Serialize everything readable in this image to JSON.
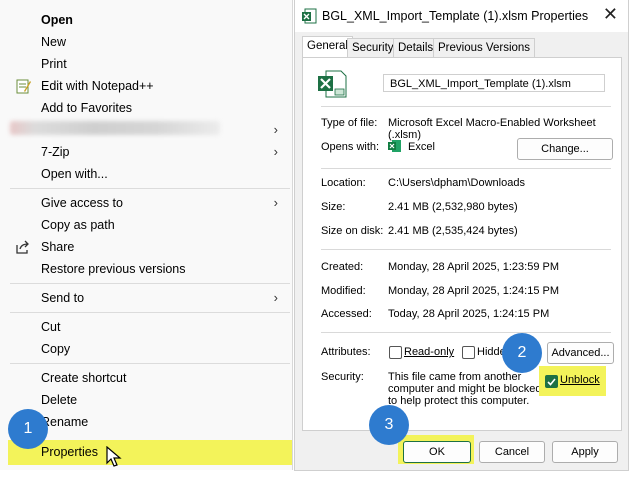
{
  "menu": {
    "items": [
      {
        "label": "Open",
        "bold": true
      },
      {
        "label": "New"
      },
      {
        "label": "Print"
      },
      {
        "label": "Edit with Notepad++",
        "icon": "notepad-icon"
      },
      {
        "label": "Add to Favorites"
      },
      {
        "label": "7-Zip",
        "arrow": "›"
      },
      {
        "label": "Open with..."
      },
      {
        "label": "Give access to",
        "arrow": "›"
      },
      {
        "label": "Copy as path"
      },
      {
        "label": "Share",
        "icon": "share-icon"
      },
      {
        "label": "Restore previous versions"
      },
      {
        "label": "Send to",
        "arrow": "›"
      },
      {
        "label": "Cut"
      },
      {
        "label": "Copy"
      },
      {
        "label": "Create shortcut"
      },
      {
        "label": "Delete"
      },
      {
        "label": "Rename"
      },
      {
        "label": "Properties"
      }
    ],
    "blurred_arrow": "›"
  },
  "dialog": {
    "title": "BGL_XML_Import_Template (1).xlsm Properties",
    "close": "✕",
    "tabs": [
      "General",
      "Security",
      "Details",
      "Previous Versions"
    ],
    "filename": "BGL_XML_Import_Template (1).xlsm",
    "type_label": "Type of file:",
    "type_value": "Microsoft Excel Macro-Enabled Worksheet (.xlsm)",
    "opens_label": "Opens with:",
    "opens_value": "Excel",
    "change_btn": "Change...",
    "location_label": "Location:",
    "location_value": "C:\\Users\\dpham\\Downloads",
    "size_label": "Size:",
    "size_value": "2.41 MB (2,532,980 bytes)",
    "disk_label": "Size on disk:",
    "disk_value": "2.41 MB (2,535,424 bytes)",
    "created_label": "Created:",
    "created_value": "Monday, 28 April 2025, 1:23:59 PM",
    "modified_label": "Modified:",
    "modified_value": "Monday, 28 April 2025, 1:24:15 PM",
    "accessed_label": "Accessed:",
    "accessed_value": "Today, 28 April 2025, 1:24:15 PM",
    "attributes_label": "Attributes:",
    "readonly": "Read-only",
    "hidden": "Hidden",
    "advanced_btn": "Advanced...",
    "security_label": "Security:",
    "security_text": "This file came from another computer and might be blocked to help protect this computer.",
    "unblock": "Unblock",
    "ok": "OK",
    "cancel": "Cancel",
    "apply": "Apply"
  },
  "badges": [
    "1",
    "2",
    "3"
  ],
  "colors": {
    "highlight": "#f3f35a",
    "badge": "#2e7bcf",
    "excel": "#1d7044"
  }
}
